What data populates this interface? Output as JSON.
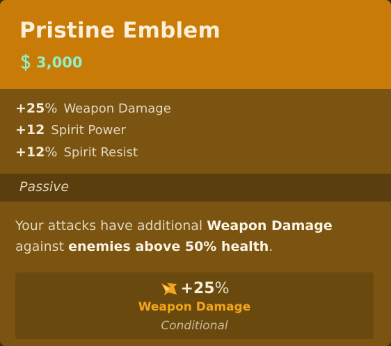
{
  "item": {
    "name": "Pristine Emblem",
    "price": "3,000",
    "colors": {
      "header": "#c97b07",
      "body": "#7a5410",
      "passive_bar": "#5a3e0e",
      "price": "#8ef2c6",
      "accent": "#f2a51c"
    }
  },
  "stats": [
    {
      "value": "+25",
      "unit": "%",
      "label": "Weapon Damage"
    },
    {
      "value": "+12",
      "unit": "",
      "label": "Spirit Power"
    },
    {
      "value": "+12",
      "unit": "%",
      "label": "Spirit Resist"
    }
  ],
  "passive": {
    "label": "Passive",
    "description": {
      "part1": "Your attacks have additional ",
      "hl1": "Weapon Damage",
      "part2": " against ",
      "hl2": "enemies above 50% health",
      "part3": "."
    },
    "bonus": {
      "icon": "weapon-damage-icon",
      "value": "+25",
      "unit": "%",
      "name": "Weapon Damage",
      "note": "Conditional"
    }
  }
}
